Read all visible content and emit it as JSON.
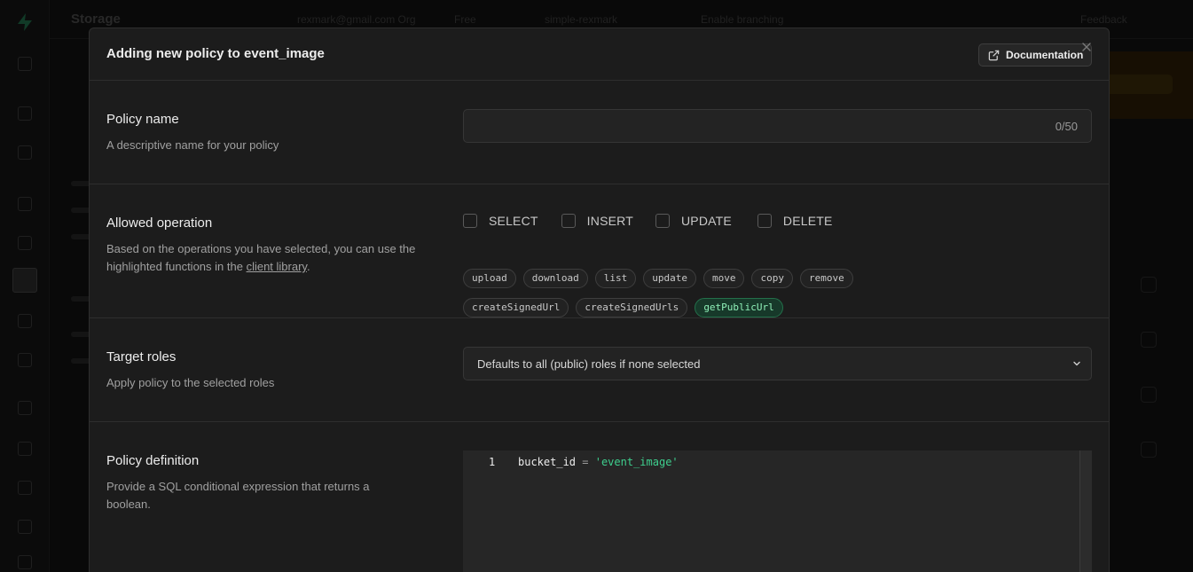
{
  "background": {
    "title": "Storage",
    "breadcrumbs": [
      "rexmark@gmail.com Org",
      "Free",
      "simple-rexmark",
      "Enable branching"
    ],
    "feedback": "Feedback"
  },
  "modal": {
    "title": "Adding new policy to event_image",
    "documentation_label": "Documentation",
    "policy_name": {
      "title": "Policy name",
      "description": "A descriptive name for your policy",
      "value": "",
      "counter": "0/50"
    },
    "allowed_operation": {
      "title": "Allowed operation",
      "description_prefix": "Based on the operations you have selected, you can use the highlighted functions in the ",
      "description_link": "client library",
      "description_suffix": ".",
      "operations": [
        {
          "label": "SELECT",
          "checked": false
        },
        {
          "label": "INSERT",
          "checked": false
        },
        {
          "label": "UPDATE",
          "checked": false
        },
        {
          "label": "DELETE",
          "checked": false
        }
      ],
      "functions_row1": [
        "upload",
        "download",
        "list",
        "update",
        "move",
        "copy",
        "remove"
      ],
      "functions_row2": [
        "createSignedUrl",
        "createSignedUrls",
        "getPublicUrl"
      ],
      "highlighted": "getPublicUrl"
    },
    "target_roles": {
      "title": "Target roles",
      "description": "Apply policy to the selected roles",
      "placeholder": "Defaults to all (public) roles if none selected"
    },
    "policy_definition": {
      "title": "Policy definition",
      "description": "Provide a SQL conditional expression that returns a boolean.",
      "line_number": "1",
      "code_ident": "bucket_id",
      "code_op": "=",
      "code_string": "'event_image'"
    }
  },
  "colors": {
    "accent_green": "#3ecf8e",
    "modal_bg": "#1c1c1c",
    "border": "#2e2e2e"
  }
}
